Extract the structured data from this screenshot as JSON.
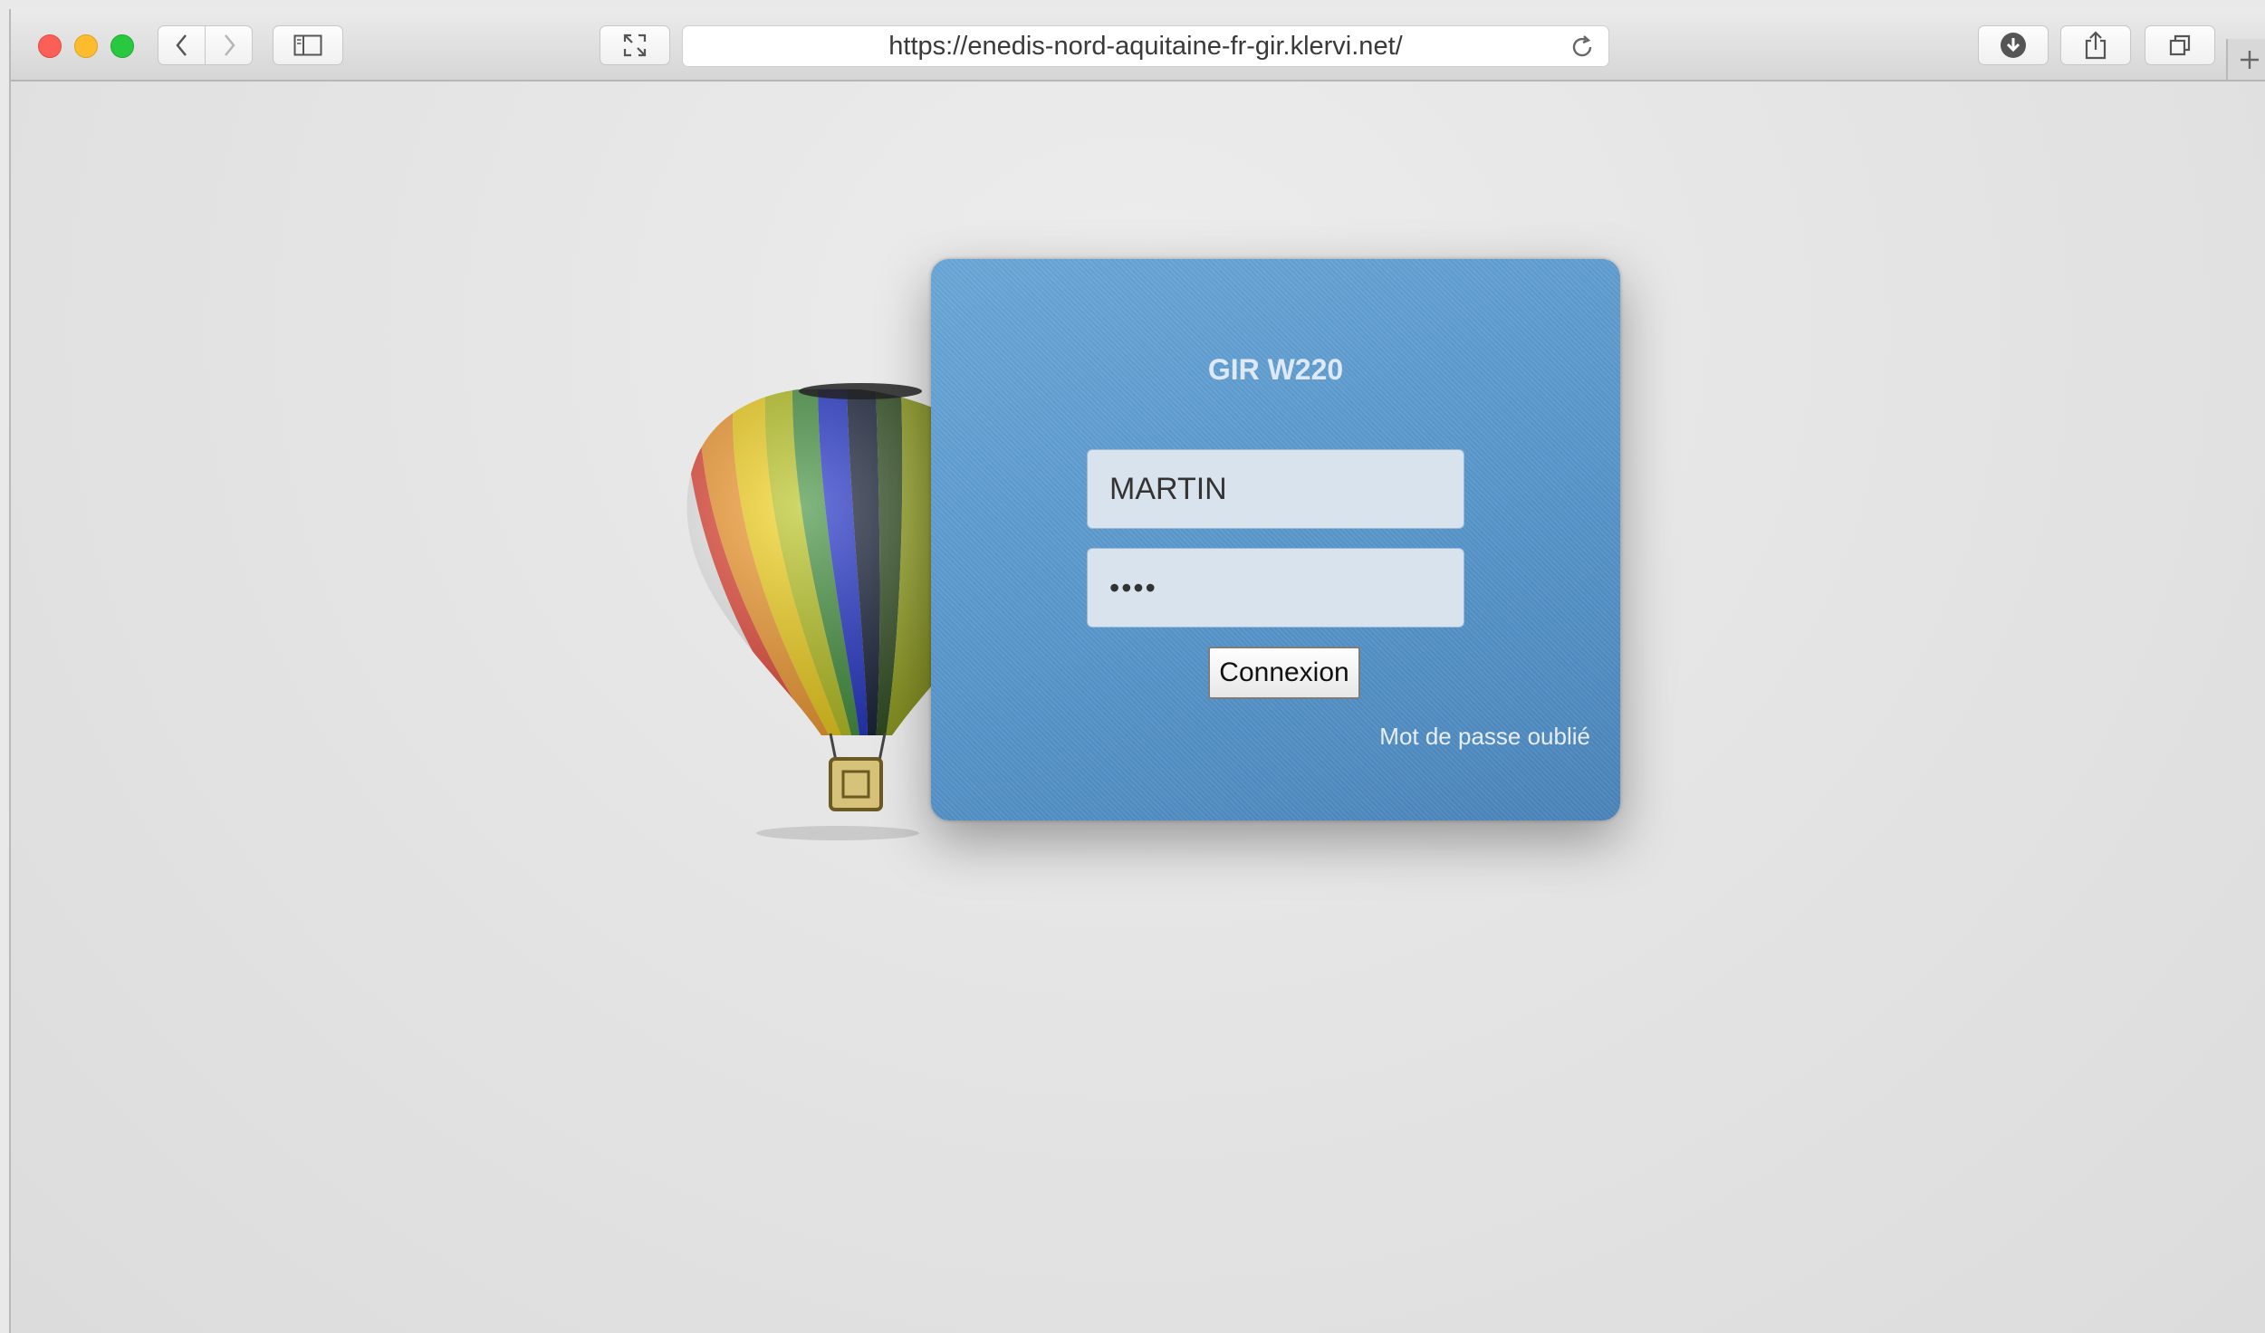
{
  "browser": {
    "url": "https://enedis-nord-aquitaine-fr-gir.klervi.net/"
  },
  "login": {
    "title": "GIR W220",
    "username_value": "MARTIN",
    "password_value": "••••",
    "submit_label": "Connexion",
    "forgot_label": "Mot de passe oublié"
  },
  "icons": {
    "balloon": "hot-air-balloon-logo"
  }
}
